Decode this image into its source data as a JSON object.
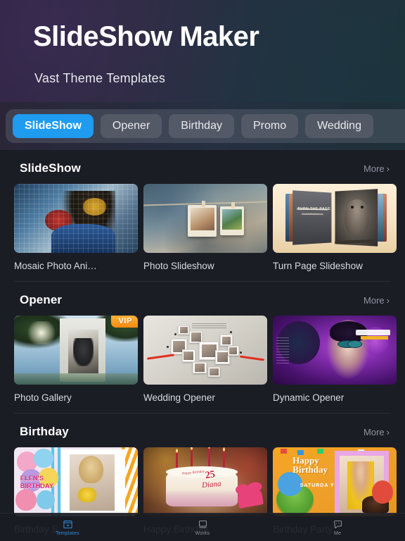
{
  "app": {
    "title": "SlideShow Maker",
    "subtitle": "Vast Theme Templates"
  },
  "filters": {
    "active": "SlideShow",
    "items": [
      {
        "label": "SlideShow",
        "active": true
      },
      {
        "label": "Opener",
        "active": false
      },
      {
        "label": "Birthday",
        "active": false
      },
      {
        "label": "Promo",
        "active": false
      },
      {
        "label": "Wedding",
        "active": false
      }
    ]
  },
  "more_label": "More",
  "more_chevron": "›",
  "sections": [
    {
      "title": "SlideShow",
      "more": "More",
      "cards": [
        {
          "label": "Mosaic Photo Ani…",
          "art": "mosaic",
          "vip": false,
          "vip_label": ""
        },
        {
          "label": "Photo Slideshow",
          "art": "hang",
          "vip": false,
          "vip_label": ""
        },
        {
          "label": "Turn Page Slideshow",
          "art": "turn",
          "vip": false,
          "vip_label": "",
          "art_text": "TURN THE PAGE",
          "art_subtext": "SLIDESHOW"
        }
      ]
    },
    {
      "title": "Opener",
      "more": "More",
      "cards": [
        {
          "label": "Photo Gallery",
          "art": "gallery",
          "vip": true,
          "vip_label": "VIP"
        },
        {
          "label": "Wedding Opener",
          "art": "wedding",
          "vip": false,
          "vip_label": ""
        },
        {
          "label": "Dynamic Opener",
          "art": "dynamic",
          "vip": false,
          "vip_label": "",
          "art_text": "YOUR HAPPY"
        }
      ]
    },
    {
      "title": "Birthday",
      "more": "More",
      "cards": [
        {
          "label": "Birthday S…",
          "art": "bday1",
          "vip": false,
          "vip_label": "",
          "art_text": "ELEN'S\nBIRTHDAY"
        },
        {
          "label": "Happy Birthday",
          "art": "bday2",
          "vip": false,
          "vip_label": "",
          "art_text": "25",
          "art_subtext": "Diana",
          "art_text3": "Happy Birthday"
        },
        {
          "label": "Birthday Party",
          "art": "bday3",
          "vip": false,
          "vip_label": "",
          "art_text": "Happy\nBirthday",
          "art_subtext": "SATURDA Y"
        }
      ]
    }
  ],
  "tabbar": {
    "items": [
      {
        "label": "Templates",
        "icon": "templates-icon",
        "active": true
      },
      {
        "label": "Works",
        "icon": "works-icon",
        "active": false
      },
      {
        "label": "Me",
        "icon": "me-icon",
        "active": false
      }
    ]
  },
  "colors": {
    "accent": "#1f9bf0",
    "vip_badge": "#f88b10",
    "background": "#1b1d25",
    "header_left": "#2e2340",
    "header_right": "#1e3038",
    "text_primary": "#ffffff",
    "text_secondary": "#8f94a0"
  }
}
